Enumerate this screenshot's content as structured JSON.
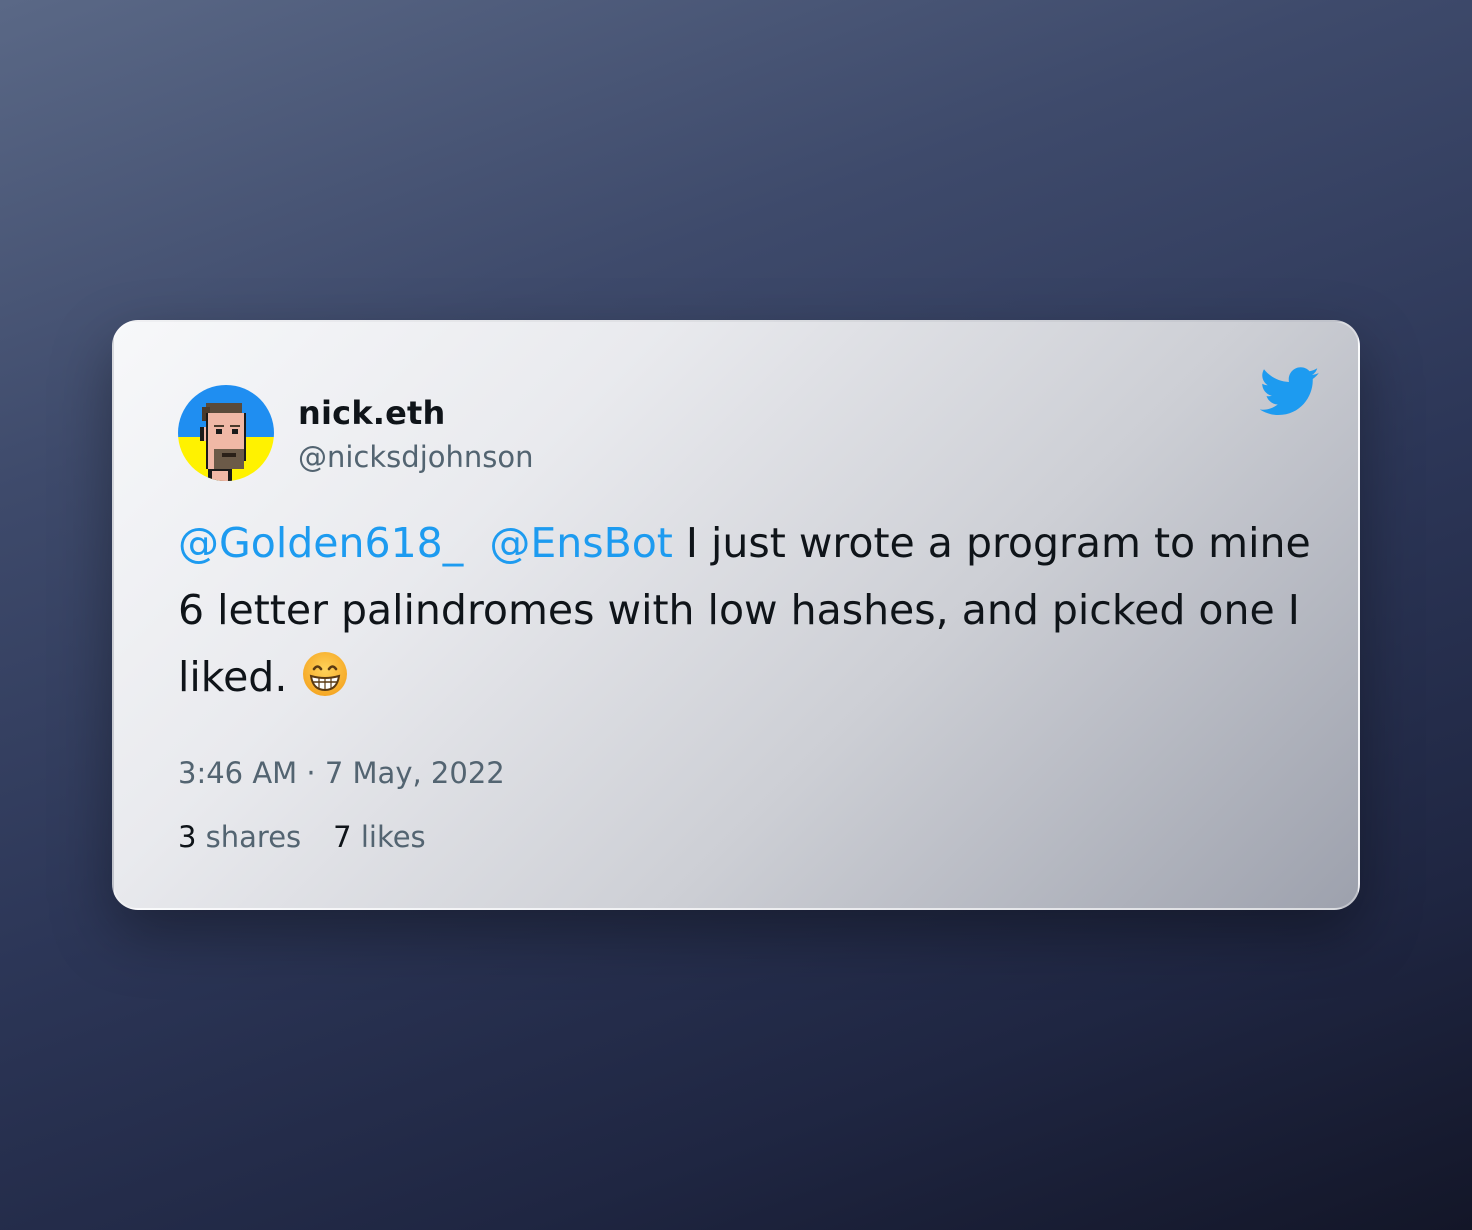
{
  "tweet": {
    "author_name": "nick.eth",
    "author_handle": "@nicksdjohnson",
    "mention_1": "@Golden618_",
    "mention_2": "@EnsBot",
    "body": " I just wrote a program to mine 6 letter palindromes with low hashes, and picked one I liked.",
    "emoji": "grinning-face-with-smiling-eyes",
    "timestamp": "3:46 AM · 7 May, 2022",
    "shares_count": "3",
    "shares_label": "shares",
    "likes_count": "7",
    "likes_label": "likes"
  },
  "icons": {
    "logo": "twitter-bird-icon"
  },
  "colors": {
    "mention": "#1d9bf0",
    "twitter_blue": "#1d9bf0",
    "avatar_top": "#1f8ef1",
    "avatar_bottom": "#fff200"
  }
}
